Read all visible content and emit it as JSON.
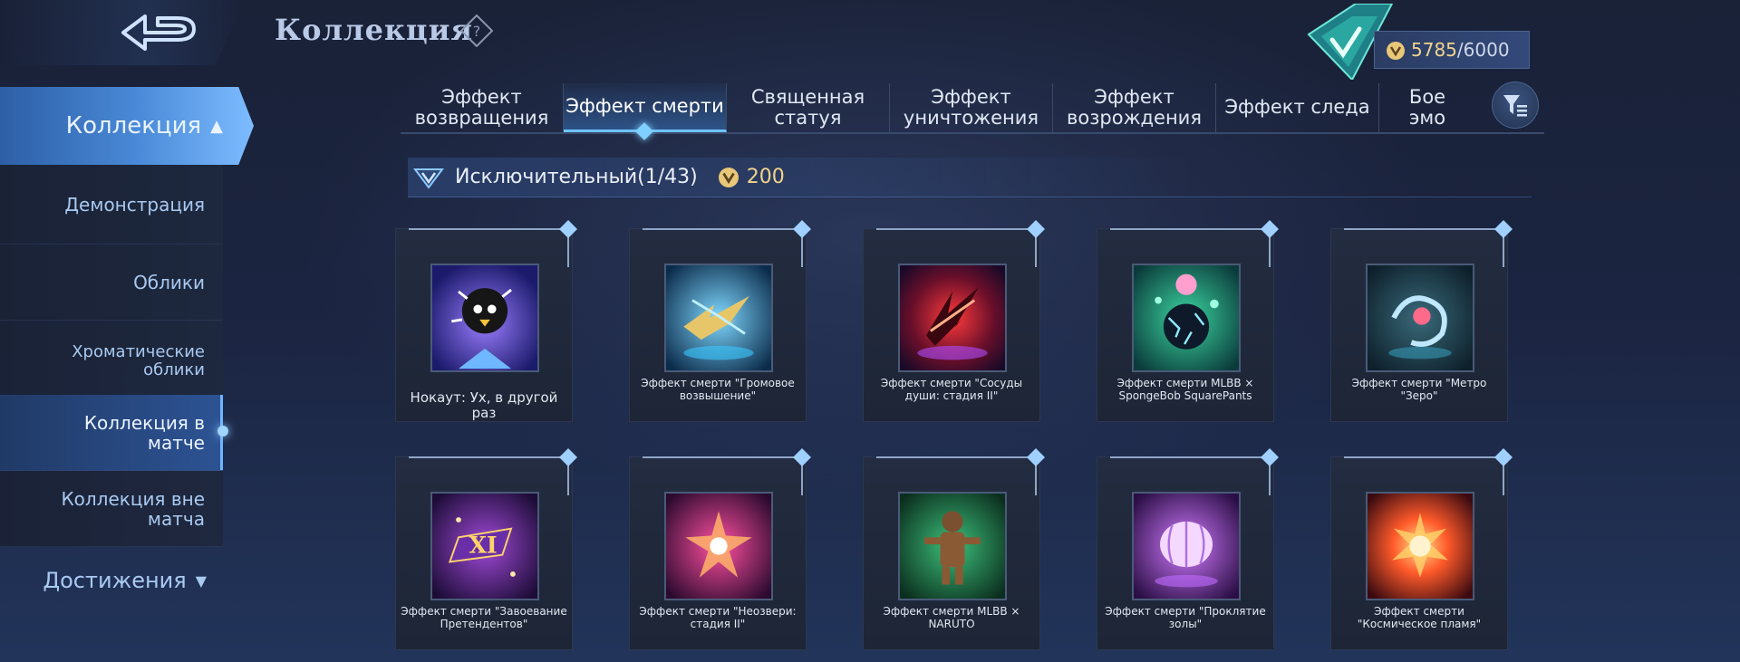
{
  "header": {
    "title": "Коллекция",
    "currency_value": "5785",
    "currency_max": "/6000"
  },
  "sidebar": {
    "active": "Коллекция",
    "items": [
      "Демонстрация",
      "Облики",
      "Хроматические облики",
      "Коллекция в матче",
      "Коллекция вне матча"
    ],
    "achievements": "Достижения"
  },
  "tabs": [
    "Эффект возвращения",
    "Эффект смерти",
    "Священная статуя",
    "Эффект уничтожения",
    "Эффект возрождения",
    "Эффект следа",
    "Бое эмо"
  ],
  "section": {
    "label": "Исключительный(1/43)",
    "price": "200"
  },
  "cards": [
    "Нокаут: Ух, в другой раз",
    "Эффект смерти \"Громовое возвышение\"",
    "Эффект смерти \"Сосуды души: стадия II\"",
    "Эффект смерти MLBB × SpongeBob SquarePants",
    "Эффект смерти \"Метро \"Зеро\"",
    "Эффект смерти \"Завоевание Претендентов\"",
    "Эффект смерти \"Неозвери: стадия II\"",
    "Эффект смерти MLBB × NARUTO",
    "Эффект смерти \"Проклятие золы\"",
    "Эффект смерти \"Космическое пламя\""
  ],
  "icons": {
    "back": "back-arrow-icon",
    "help": "question-icon",
    "rank": "rank-emblem-icon",
    "coin": "battle-point-coin-icon",
    "filter": "filter-icon"
  },
  "colors": {
    "accent": "#6ec3ff",
    "gold": "#f1d48c"
  }
}
